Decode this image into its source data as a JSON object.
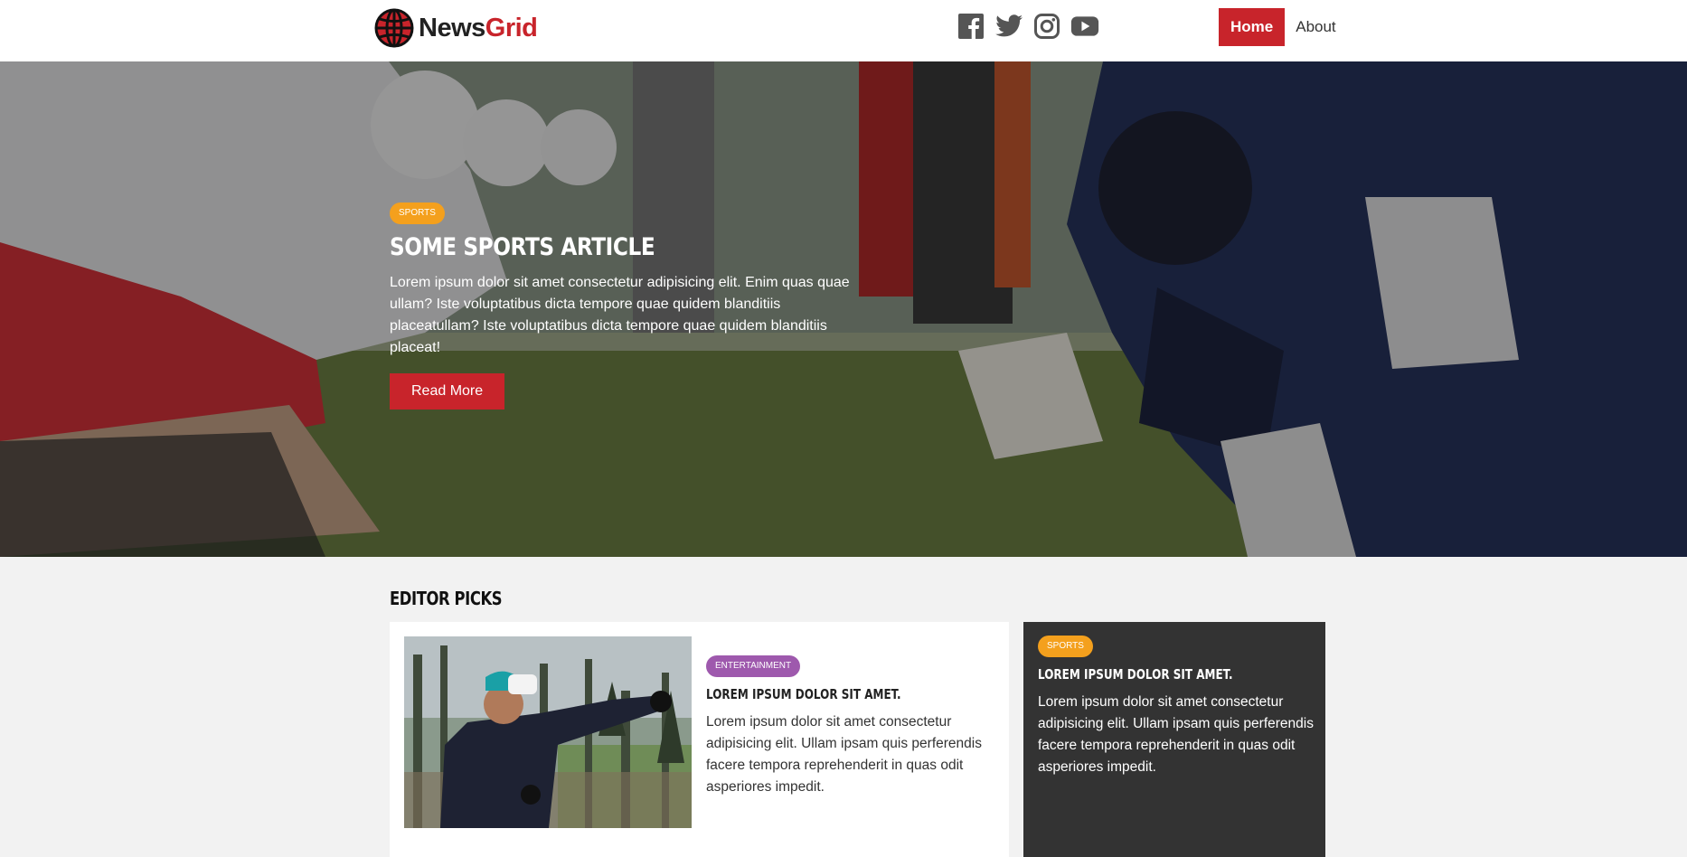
{
  "header": {
    "logo_part1": "News",
    "logo_part2": "Grid",
    "social": [
      "facebook-icon",
      "twitter-icon",
      "instagram-icon",
      "youtube-icon"
    ],
    "nav": [
      {
        "label": "Home",
        "active": true
      },
      {
        "label": "About",
        "active": false
      }
    ]
  },
  "hero": {
    "category": "SPORTS",
    "title": "Some Sports Article",
    "text": "Lorem ipsum dolor sit amet consectetur adipisicing elit. Enim quas quae ullam? Iste voluptatibus dicta tempore quae quidem blanditiis placeatullam? Iste voluptatibus dicta tempore quae quidem blanditiis placeat!",
    "button": "Read More"
  },
  "editor_picks": {
    "title": "Editor Picks",
    "main_card": {
      "category": "ENTERTAINMENT",
      "title": "Lorem ipsum dolor sit amet.",
      "text": "Lorem ipsum dolor sit amet consectetur adipisicing elit. Ullam ipsam quis perferendis facere tempora reprehenderit in quas odit asperiores impedit."
    },
    "side_card": {
      "category": "SPORTS",
      "title": "Lorem ipsum dolor sit amet.",
      "text": "Lorem ipsum dolor sit amet consectetur adipisicing elit. Ullam ipsam quis perferendis facere tempora reprehenderit in quas odit asperiores impedit."
    }
  },
  "colors": {
    "brand_red": "#c8242b",
    "sports_orange": "#f4a01d",
    "entertainment_purple": "#9e59ad",
    "dark_card": "#333333"
  }
}
